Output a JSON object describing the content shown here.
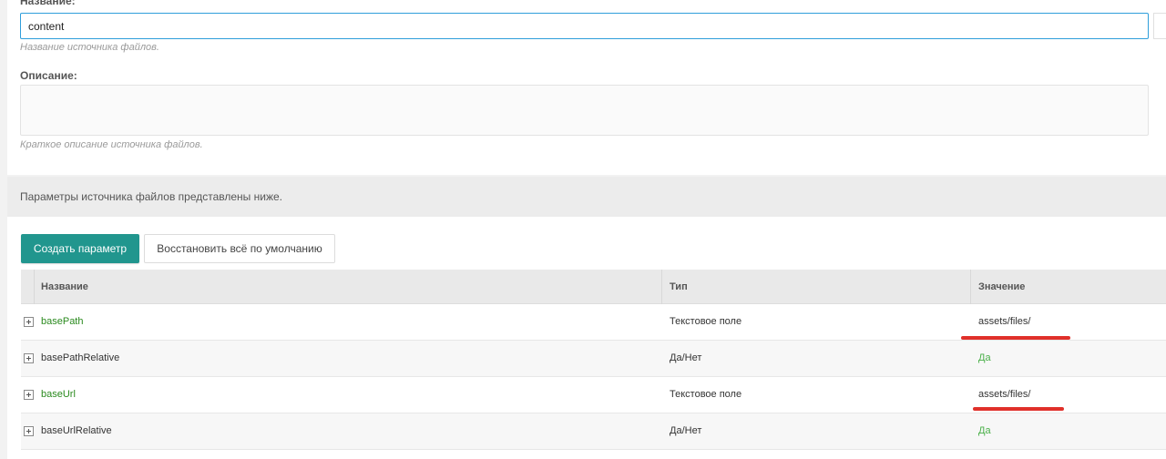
{
  "form": {
    "name_label": "Название:",
    "name_value": "content",
    "name_hint": "Название источника файлов.",
    "desc_label": "Описание:",
    "desc_value": "",
    "desc_hint": "Краткое описание источника файлов."
  },
  "info_text": "Параметры источника файлов представлены ниже.",
  "toolbar": {
    "create_label": "Создать параметр",
    "restore_label": "Восстановить всё по умолчанию"
  },
  "grid": {
    "columns": [
      "Название",
      "Тип",
      "Значение"
    ],
    "rows": [
      {
        "name": "basePath",
        "type": "Текстовое поле",
        "value": "assets/files/",
        "highlighted": true
      },
      {
        "name": "basePathRelative",
        "type": "Да/Нет",
        "value": "Да",
        "highlighted": false
      },
      {
        "name": "baseUrl",
        "type": "Текстовое поле",
        "value": "assets/files/",
        "highlighted": true
      },
      {
        "name": "baseUrlRelative",
        "type": "Да/Нет",
        "value": "Да",
        "highlighted": false
      }
    ]
  },
  "colors": {
    "accent": "#21968e",
    "focus_border": "#2f9edb",
    "modified_name": "#2a8a1e",
    "bool_value": "#4bb04a",
    "annotation": "#e0302a"
  }
}
